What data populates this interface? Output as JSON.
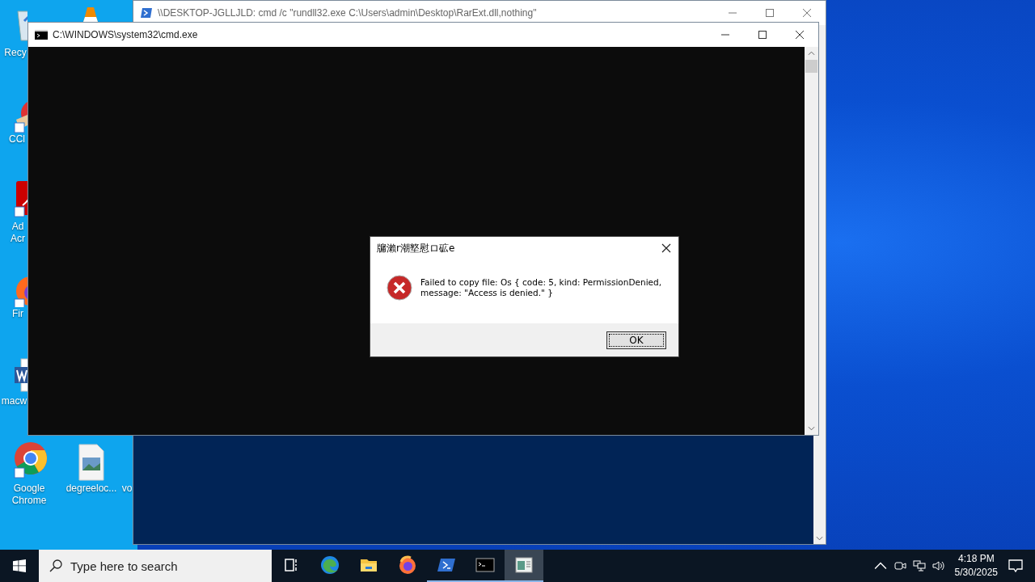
{
  "desktop": {
    "icons": [
      {
        "kind": "recycle",
        "lines": [
          "Recy"
        ]
      },
      {
        "kind": "vlc"
      },
      {
        "kind": "ccleaner",
        "lines": [
          "CCl"
        ]
      },
      {
        "kind": "acrobat",
        "lines": [
          "Ad",
          "Acr"
        ]
      },
      {
        "kind": "firefox",
        "lines": [
          "Fir"
        ]
      },
      {
        "kind": "word",
        "lines": [
          "macw"
        ]
      },
      {
        "kind": "chrome",
        "lines": [
          "Google",
          "Chrome"
        ]
      },
      {
        "kind": "image",
        "lines": [
          "degreeloc..."
        ]
      },
      {
        "kind": "none",
        "lines": [
          "vo"
        ]
      }
    ]
  },
  "powershell_window": {
    "title": "\\\\DESKTOP-JGLLJLD: cmd /c \"rundll32.exe C:\\Users\\admin\\Desktop\\RarExt.dll,nothing\""
  },
  "cmd_window": {
    "title": "C:\\WINDOWS\\system32\\cmd.exe"
  },
  "dialog": {
    "title": "牖瀨r潮墪慰ロ砿e",
    "message": "Failed to copy file: Os { code: 5, kind: PermissionDenied, message: \"Access is denied.\" }",
    "button": "OK"
  },
  "taskbar": {
    "search": {
      "placeholder": "Type here to search"
    },
    "apps": [
      {
        "kind": "taskview",
        "running": false,
        "selected": false
      },
      {
        "kind": "edge",
        "running": false,
        "selected": false
      },
      {
        "kind": "explorer",
        "running": false,
        "selected": false
      },
      {
        "kind": "firefox",
        "running": false,
        "selected": false
      },
      {
        "kind": "powershell",
        "running": true,
        "selected": false
      },
      {
        "kind": "cmd",
        "running": true,
        "selected": false
      },
      {
        "kind": "app",
        "running": true,
        "selected": true
      }
    ],
    "time": "4:18 PM",
    "date": "5/30/2025"
  }
}
